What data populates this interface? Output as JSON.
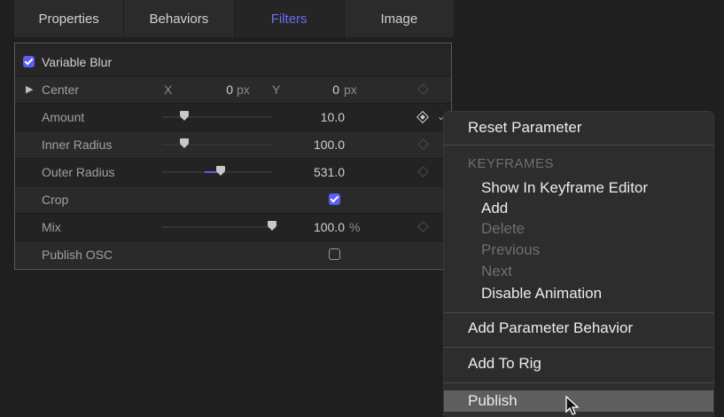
{
  "tabs": [
    "Properties",
    "Behaviors",
    "Filters",
    "Image"
  ],
  "active_tab": "Filters",
  "filter": {
    "name": "Variable Blur",
    "enabled": true
  },
  "params": {
    "center": {
      "label": "Center",
      "x_label": "X",
      "x_value": "0",
      "x_unit": "px",
      "y_label": "Y",
      "y_value": "0",
      "y_unit": "px"
    },
    "amount": {
      "label": "Amount",
      "value": "10.0",
      "slider_fraction": 0.2
    },
    "inner_radius": {
      "label": "Inner Radius",
      "value": "100.0",
      "slider_fraction": 0.2
    },
    "outer_radius": {
      "label": "Outer Radius",
      "value": "531.0",
      "slider_fraction": 0.53
    },
    "crop": {
      "label": "Crop",
      "checked": true
    },
    "mix": {
      "label": "Mix",
      "value": "100.0",
      "unit": "%",
      "slider_fraction": 1.0
    },
    "publish_osc": {
      "label": "Publish OSC",
      "checked": false
    }
  },
  "menu": {
    "reset": "Reset Parameter",
    "keyframes_header": "KEYFRAMES",
    "show_in_editor": "Show In Keyframe Editor",
    "add": "Add",
    "delete": "Delete",
    "previous": "Previous",
    "next": "Next",
    "disable_animation": "Disable Animation",
    "add_param_behavior": "Add Parameter Behavior",
    "add_to_rig": "Add To Rig",
    "publish": "Publish"
  },
  "colors": {
    "accent": "#5b5ef0",
    "active_tab_text": "#6a6cf6",
    "menu_highlight": "#5e5e5e"
  }
}
